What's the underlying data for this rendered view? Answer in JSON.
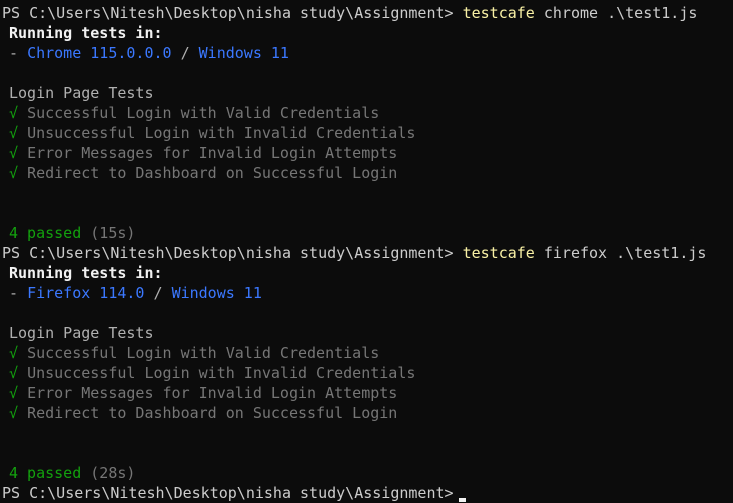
{
  "run1": {
    "prompt": "PS C:\\Users\\Nitesh\\Desktop\\nisha study\\Assignment> ",
    "command": "testcafe",
    "args": " chrome .\\test1.js",
    "running_label": "Running tests in:",
    "browser_dash": "- ",
    "browser": "Chrome 115.0.0.0",
    "browser_sep": " / ",
    "os": "Windows 11",
    "fixture": "Login Page Tests",
    "tests": [
      {
        "mark": "√",
        "name": "Successful Login with Valid Credentials"
      },
      {
        "mark": "√",
        "name": "Unsuccessful Login with Invalid Credentials"
      },
      {
        "mark": "√",
        "name": "Error Messages for Invalid Login Attempts"
      },
      {
        "mark": "√",
        "name": "Redirect to Dashboard on Successful Login"
      }
    ],
    "passed": "4 passed",
    "duration": "(15s)"
  },
  "run2": {
    "prompt": "PS C:\\Users\\Nitesh\\Desktop\\nisha study\\Assignment> ",
    "command": "testcafe",
    "args": " firefox .\\test1.js",
    "running_label": "Running tests in:",
    "browser_dash": "- ",
    "browser": "Firefox 114.0",
    "browser_sep": " / ",
    "os": "Windows 11",
    "fixture": "Login Page Tests",
    "tests": [
      {
        "mark": "√",
        "name": "Successful Login with Valid Credentials"
      },
      {
        "mark": "√",
        "name": "Unsuccessful Login with Invalid Credentials"
      },
      {
        "mark": "√",
        "name": "Error Messages for Invalid Login Attempts"
      },
      {
        "mark": "√",
        "name": "Redirect to Dashboard on Successful Login"
      }
    ],
    "passed": "4 passed",
    "duration": "(28s)"
  },
  "final_prompt": "PS C:\\Users\\Nitesh\\Desktop\\nisha study\\Assignment>",
  "colors": {
    "background": "#0c0c0c",
    "command": "#f9f1a5",
    "browser": "#3b78ff",
    "passed": "#13a10e",
    "test_name": "#767676"
  }
}
